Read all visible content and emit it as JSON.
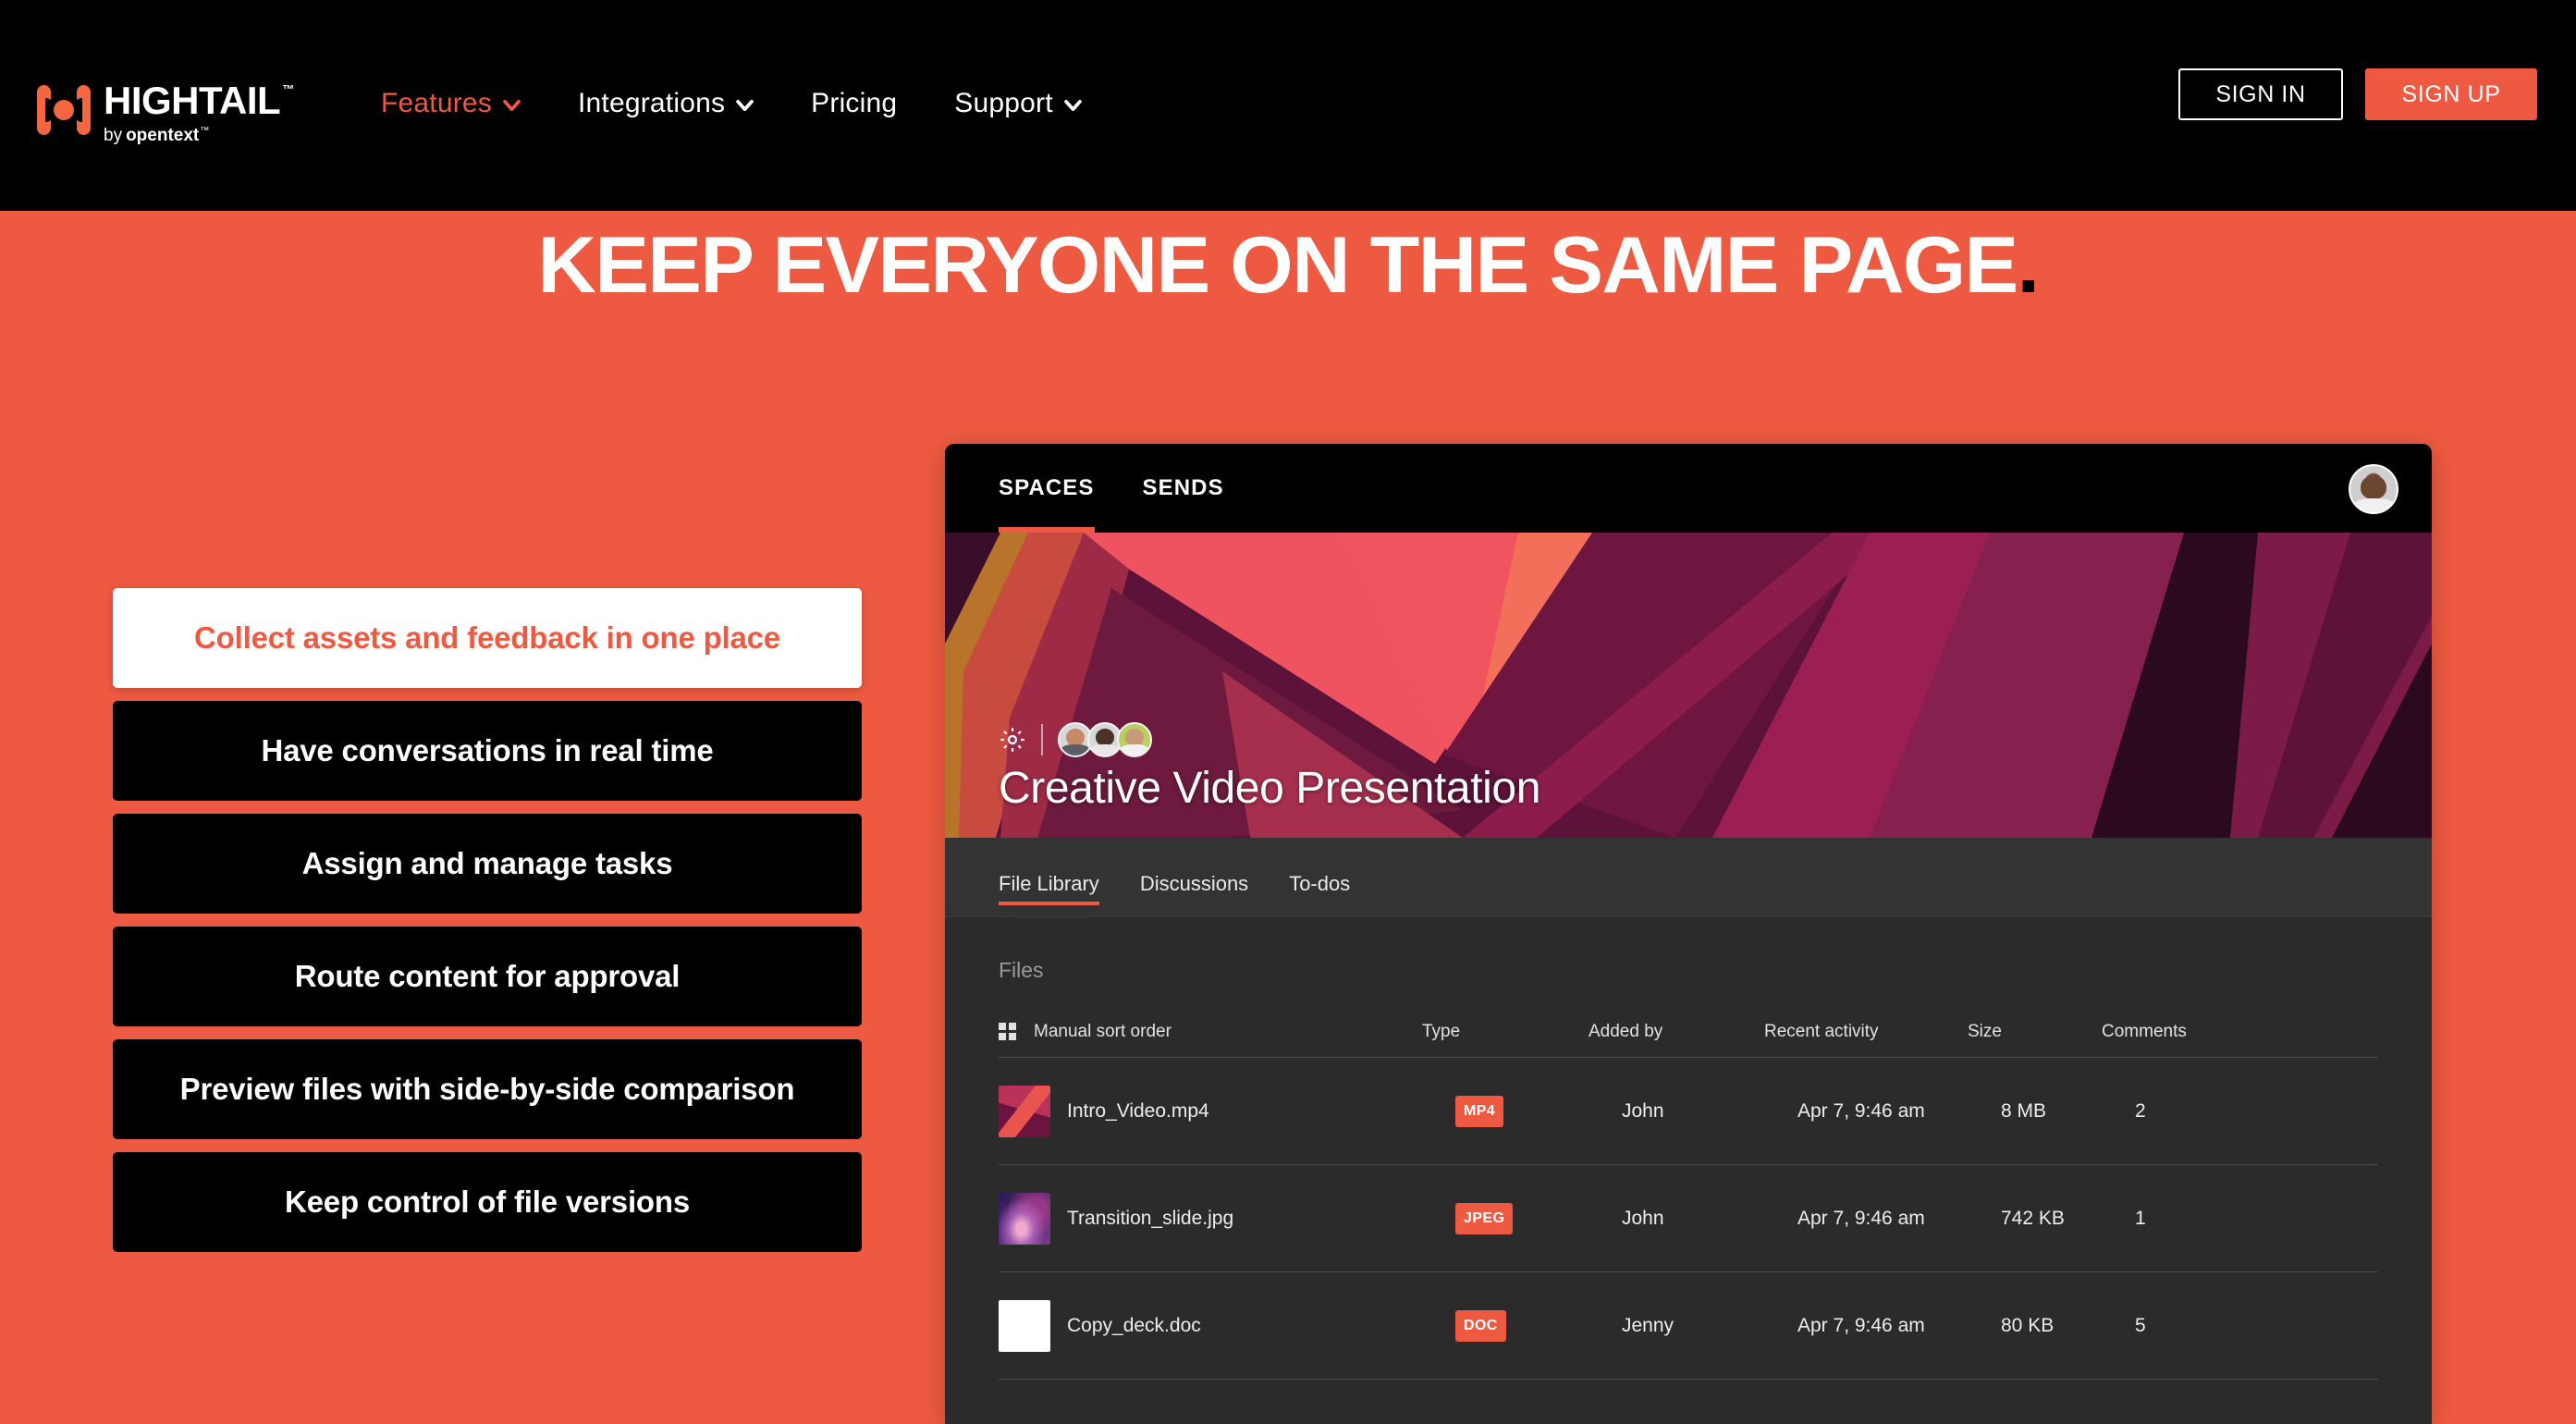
{
  "brand": {
    "name": "HIGHTAIL",
    "trademark": "™",
    "by": "by",
    "parent": "opentext",
    "parent_tm": "™",
    "accent_color": "#ee5a41",
    "logo_icon": "hightail-logo-icon"
  },
  "nav": {
    "items": [
      {
        "label": "Features",
        "has_caret": true,
        "active": true
      },
      {
        "label": "Integrations",
        "has_caret": true,
        "active": false
      },
      {
        "label": "Pricing",
        "has_caret": false,
        "active": false
      },
      {
        "label": "Support",
        "has_caret": true,
        "active": false
      }
    ],
    "sign_in": "SIGN IN",
    "sign_up": "SIGN UP"
  },
  "hero": {
    "headline": "KEEP EVERYONE ON THE SAME PAGE",
    "headline_period": ".",
    "background_color": "#ee5a41"
  },
  "accordion": {
    "items": [
      {
        "label": "Collect assets and feedback in one place",
        "active": true
      },
      {
        "label": "Have conversations in real time",
        "active": false
      },
      {
        "label": "Assign and manage tasks",
        "active": false
      },
      {
        "label": "Route content for approval",
        "active": false
      },
      {
        "label": "Preview files with side-by-side comparison",
        "active": false
      },
      {
        "label": "Keep control of file versions",
        "active": false
      }
    ]
  },
  "app": {
    "top_tabs": [
      {
        "label": "SPACES",
        "active": true
      },
      {
        "label": "SENDS",
        "active": false
      }
    ],
    "account_avatar": "user-avatar",
    "banner": {
      "title": "Creative Video Presentation",
      "settings_icon": "gear-icon",
      "member_avatars": [
        "member-avatar-1",
        "member-avatar-2",
        "member-avatar-3"
      ]
    },
    "sub_tabs": [
      {
        "label": "File Library",
        "active": true
      },
      {
        "label": "Discussions",
        "active": false
      },
      {
        "label": "To-dos",
        "active": false
      }
    ],
    "files_section": {
      "section_label": "Files",
      "sort_icon": "grid-sort-icon",
      "columns": [
        "Manual sort order",
        "Type",
        "Added by",
        "Recent activity",
        "Size",
        "Comments"
      ],
      "rows": [
        {
          "thumbnail": "geometric-abstract-thumb",
          "name": "Intro_Video.mp4",
          "type": "MP4",
          "added_by": "John",
          "recent_activity": "Apr 7, 9:46 am",
          "size": "8 MB",
          "comments": "2"
        },
        {
          "thumbnail": "purple-nebula-thumb",
          "name": "Transition_slide.jpg",
          "type": "JPEG",
          "added_by": "John",
          "recent_activity": "Apr 7, 9:46 am",
          "size": "742 KB",
          "comments": "1"
        },
        {
          "thumbnail": "document-page-thumb",
          "name": "Copy_deck.doc",
          "type": "DOC",
          "added_by": "Jenny",
          "recent_activity": "Apr 7, 9:46 am",
          "size": "80 KB",
          "comments": "5"
        }
      ]
    }
  }
}
